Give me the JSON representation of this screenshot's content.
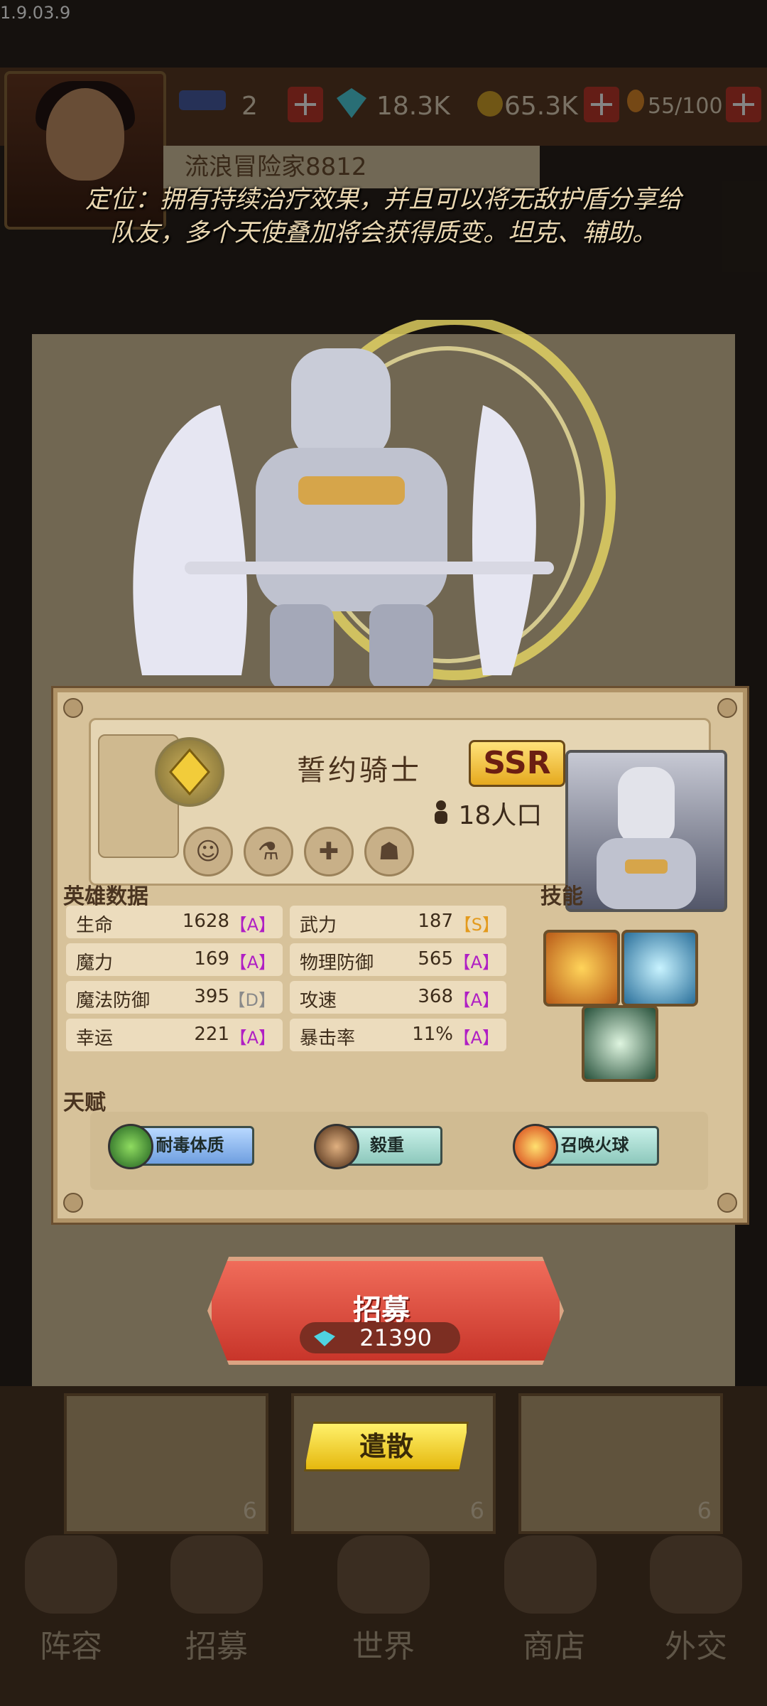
{
  "version": "1.9.03.9",
  "resources": {
    "tickets": "2",
    "gems": "18.3K",
    "gold": "65.3K",
    "food": "55/100"
  },
  "player_name": "流浪冒险家8812",
  "hero": {
    "description_line1": "定位：拥有持续治疗效果，并且可以将无敌护盾分享给",
    "description_line2": "队友，多个天使叠加将会获得质变。坦克、辅助。",
    "name": "誓约骑士",
    "rarity": "SSR",
    "population": "18人口"
  },
  "sections": {
    "stats_title": "英雄数据",
    "skills_title": "技能",
    "talent_title": "天赋"
  },
  "stats": [
    {
      "label": "生命",
      "value": "1628",
      "grade": "【A】"
    },
    {
      "label": "武力",
      "value": "187",
      "grade": "【S】"
    },
    {
      "label": "魔力",
      "value": "169",
      "grade": "【A】"
    },
    {
      "label": "物理防御",
      "value": "565",
      "grade": "【A】"
    },
    {
      "label": "魔法防御",
      "value": "395",
      "grade": "【D】"
    },
    {
      "label": "攻速",
      "value": "368",
      "grade": "【A】"
    },
    {
      "label": "幸运",
      "value": "221",
      "grade": "【A】"
    },
    {
      "label": "暴击率",
      "value": "11%",
      "grade": "【A】"
    }
  ],
  "talents": [
    "耐毒体质",
    "毅重",
    "召唤火球"
  ],
  "recruit": {
    "label": "招募",
    "cost": "21390"
  },
  "dismiss_label": "遣散",
  "bg_cards": [
    {
      "count": "6"
    },
    {
      "count": "6"
    },
    {
      "count": "6"
    }
  ],
  "tabs": [
    "阵容",
    "招募",
    "世界",
    "商店",
    "外交"
  ],
  "colors": {
    "grade_A": "#b01fc4",
    "grade_S": "#e39a1d",
    "grade_D": "#8a8a8a",
    "rarity_gold": "#f4c430",
    "recruit_red": "#d9463a"
  }
}
